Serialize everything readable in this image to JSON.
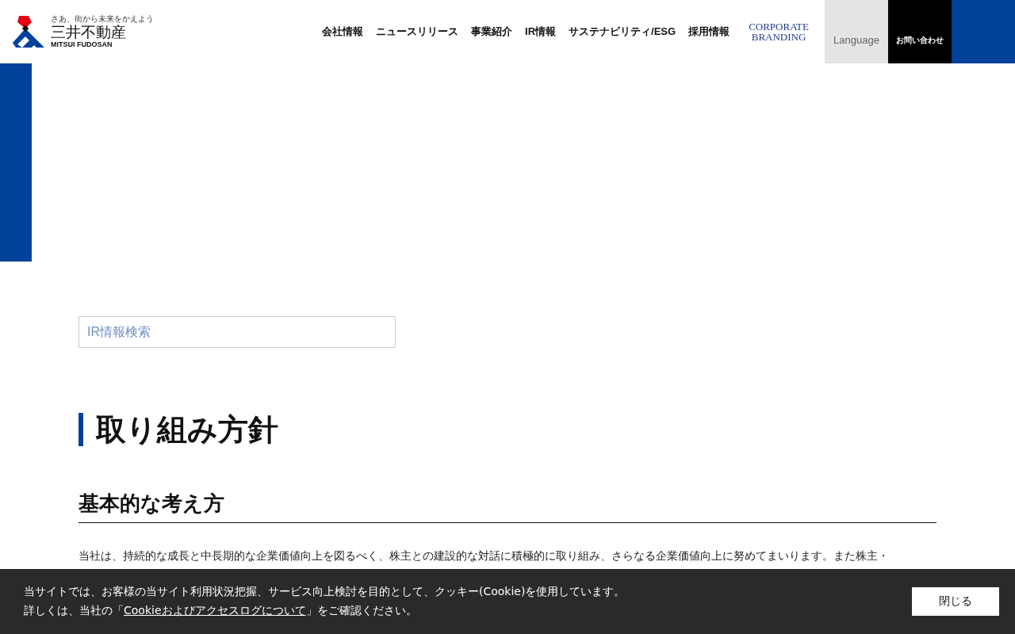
{
  "header": {
    "logo": {
      "tagline": "さあ、街から未来をかえよう",
      "name": "三井不動産",
      "roman": "MITSUI FUDOSAN"
    },
    "nav": [
      "会社情報",
      "ニュースリリース",
      "事業紹介",
      "IR情報",
      "サステナビリティ/ESG",
      "採用情報"
    ],
    "branding": [
      "CORPORATE",
      "BRANDING"
    ],
    "language": "Language",
    "contact": "お問い合わせ"
  },
  "search": {
    "placeholder": "IR情報検索"
  },
  "page_title": "取り組み方針",
  "section_title": "基本的な考え方",
  "paragraph": "当社は、持続的な成長と中長期的な企業価値向上を図るべく、株主との建設的な対話に積極的に取り組み、さらなる企業価値向上に努めてまいります。また株主・",
  "cookie_banner": {
    "line_1": "当サイトでは、お客様の当サイト利用状況把握、サービス向上検討を目的として、クッキー(Cookie)を使用しています。",
    "line_2_before": "詳しくは、当社の「",
    "link": "Cookieおよびアクセスログについて",
    "line_2_after": "」をご確認ください。",
    "close": "閉じる"
  }
}
